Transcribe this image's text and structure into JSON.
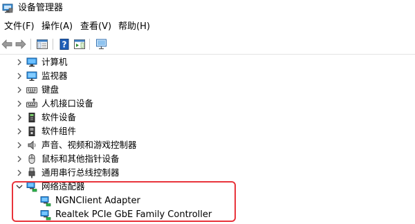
{
  "window": {
    "title": "设备管理器",
    "app_icon": "device-manager-icon"
  },
  "menu": [
    {
      "label": "文件(F)"
    },
    {
      "label": "操作(A)"
    },
    {
      "label": "查看(V)"
    },
    {
      "label": "帮助(H)"
    }
  ],
  "toolbar": {
    "buttons": [
      "back-arrow-icon",
      "forward-arrow-icon",
      "show-hide-console-tree-icon",
      "help-icon",
      "action-pane-icon",
      "monitor-scan-icon"
    ]
  },
  "tree": {
    "nodes": [
      {
        "label": "计算机",
        "icon": "computer-icon",
        "expanded": false
      },
      {
        "label": "监视器",
        "icon": "monitor-icon",
        "expanded": false
      },
      {
        "label": "键盘",
        "icon": "keyboard-icon",
        "expanded": false
      },
      {
        "label": "人机接口设备",
        "icon": "hid-icon",
        "expanded": false
      },
      {
        "label": "软件设备",
        "icon": "software-device-icon",
        "expanded": false
      },
      {
        "label": "软件组件",
        "icon": "software-component-icon",
        "expanded": false
      },
      {
        "label": "声音、视频和游戏控制器",
        "icon": "speaker-icon",
        "expanded": false
      },
      {
        "label": "鼠标和其他指针设备",
        "icon": "mouse-icon",
        "expanded": false
      },
      {
        "label": "通用串行总线控制器",
        "icon": "usb-icon",
        "expanded": false
      },
      {
        "label": "网络适配器",
        "icon": "network-adapter-icon",
        "expanded": true,
        "children": [
          {
            "label": "NGNClient Adapter",
            "icon": "network-adapter-icon"
          },
          {
            "label": "Realtek PCIe GbE Family Controller",
            "icon": "network-adapter-icon"
          }
        ]
      }
    ]
  },
  "highlight": {
    "color": "#e8333a"
  }
}
